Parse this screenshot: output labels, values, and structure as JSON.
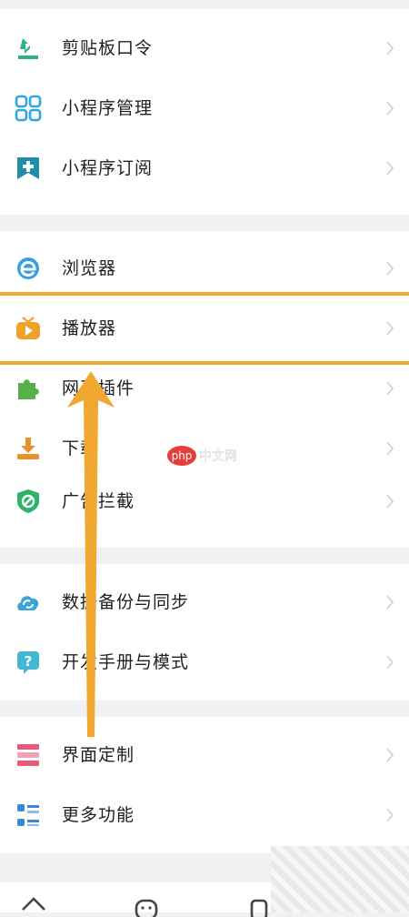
{
  "groups": [
    {
      "items": [
        {
          "label": "剪贴板口令",
          "icon": "clipboard-download-icon",
          "color": "#2db08a"
        },
        {
          "label": "小程序管理",
          "icon": "grid-apps-icon",
          "color": "#2ea7e0"
        },
        {
          "label": "小程序订阅",
          "icon": "subscribe-plus-icon",
          "color": "#1f8ea8"
        }
      ]
    },
    {
      "items": [
        {
          "label": "浏览器",
          "icon": "browser-e-icon",
          "color": "#3a9ee4"
        },
        {
          "label": "播放器",
          "icon": "tv-player-icon",
          "color": "#f0a12a"
        },
        {
          "label": "网页插件",
          "icon": "puzzle-icon",
          "color": "#58b04a"
        },
        {
          "label": "下载",
          "icon": "download-icon",
          "color": "#e8922c"
        },
        {
          "label": "广告拦截",
          "icon": "ad-block-shield-icon",
          "color": "#2cb56a"
        }
      ]
    },
    {
      "items": [
        {
          "label": "数据备份与同步",
          "icon": "cloud-sync-icon",
          "color": "#3aa6d8"
        },
        {
          "label": "开发手册与模式",
          "icon": "help-chat-icon",
          "color": "#43b8d3"
        }
      ]
    },
    {
      "items": [
        {
          "label": "界面定制",
          "icon": "layout-custom-icon",
          "color": "#e95a7a"
        },
        {
          "label": "更多功能",
          "icon": "list-more-icon",
          "color": "#3b86d6"
        }
      ]
    }
  ],
  "annotation": {
    "color": "#f0a830",
    "highlighted": "播放器"
  },
  "watermark": {
    "text": "php中文网"
  }
}
